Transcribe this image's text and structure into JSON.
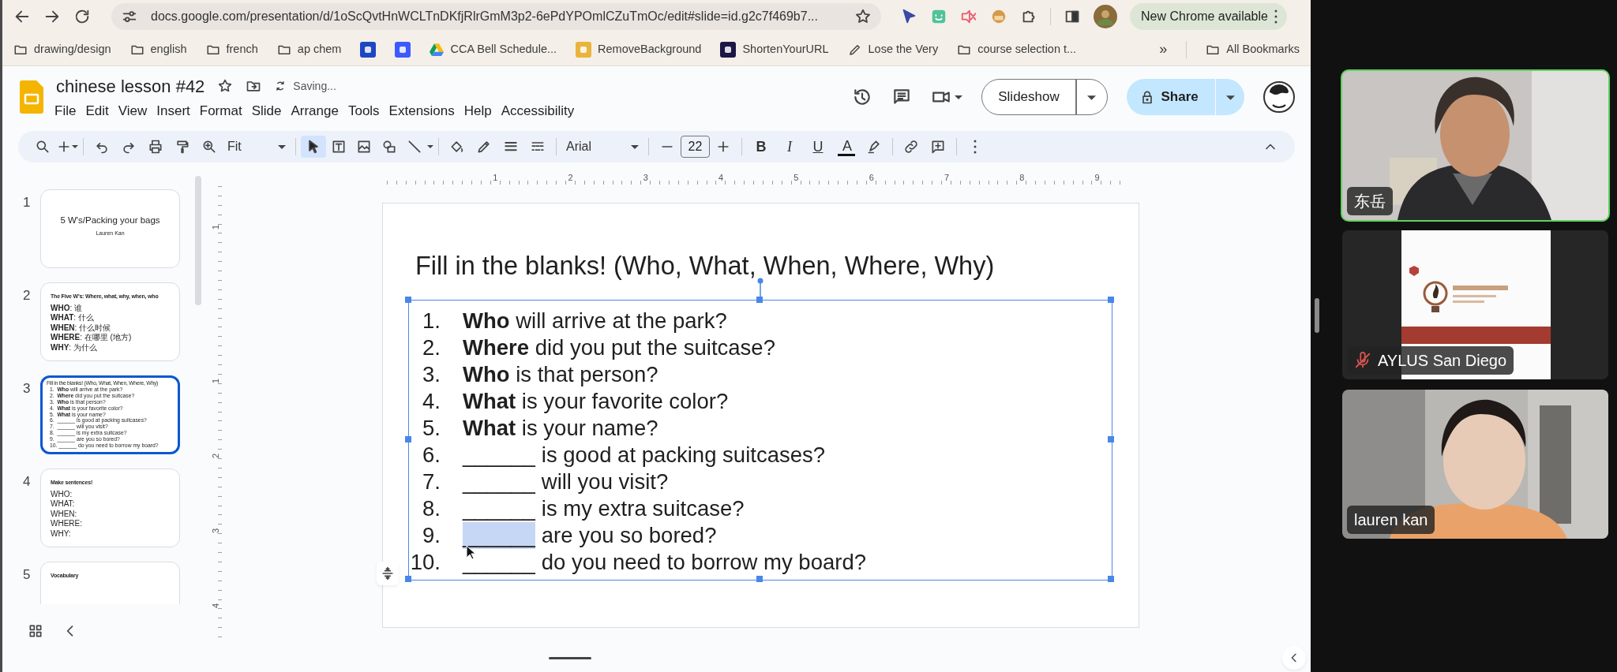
{
  "browser": {
    "url": "docs.google.com/presentation/d/1oScQvtHnWCLTnDKfjRlrGmM3p2-6ePdYPOmlCZuTmOc/edit#slide=id.g2c7f469b7...",
    "update_button": "New Chrome available",
    "bookmarks": [
      {
        "kind": "folder",
        "label": "drawing/design"
      },
      {
        "kind": "folder",
        "label": "english"
      },
      {
        "kind": "folder",
        "label": "french"
      },
      {
        "kind": "folder",
        "label": "ap chem"
      },
      {
        "kind": "favicon",
        "color": "#1e46c4"
      },
      {
        "kind": "favicon",
        "color": "#3d5afe"
      },
      {
        "kind": "drive",
        "label": "CCA Bell Schedule..."
      },
      {
        "kind": "favicon",
        "color": "#e9b43c",
        "label": "RemoveBackground"
      },
      {
        "kind": "favicon",
        "color": "#1c1845",
        "label": "ShortenYourURL"
      },
      {
        "kind": "pencil",
        "label": "Lose the Very"
      },
      {
        "kind": "folder",
        "label": "course selection t..."
      }
    ],
    "overflow": "»",
    "all_bookmarks": "All Bookmarks"
  },
  "app": {
    "title": "chinese lesson #42",
    "save_status": "Saving...",
    "menu": [
      "File",
      "Edit",
      "View",
      "Insert",
      "Format",
      "Slide",
      "Arrange",
      "Tools",
      "Extensions",
      "Help",
      "Accessibility"
    ],
    "slideshow_button": "Slideshow",
    "share_button": "Share"
  },
  "toolbar": {
    "zoom": "Fit",
    "tools": [
      {
        "selected": true
      },
      {
        "selected": false
      },
      {
        "selected": false
      },
      {
        "selected": false
      },
      {
        "selected": false
      }
    ],
    "font": "Arial",
    "font_size": "22",
    "format_buttons": [
      "B",
      "I",
      "U",
      "A"
    ]
  },
  "rulers": {
    "horizontal": [
      "1",
      "2",
      "3",
      "4",
      "5",
      "6",
      "7",
      "8",
      "9"
    ],
    "vertical": [
      "1",
      "1",
      "2",
      "3",
      "4"
    ]
  },
  "thumbnails": [
    {
      "number": "1",
      "selected": false,
      "kind": "title",
      "title": "5 W's/Packing your bags",
      "subtitle": "Lauren Kan"
    },
    {
      "number": "2",
      "selected": false,
      "kind": "list",
      "heading": "The Five W's: Where, what, why, when, who",
      "lines": [
        "**WHO**: 谁",
        "**WHAT**: 什么",
        "**WHEN**: 什么时候",
        "**WHERE**: 在哪里 (地方)",
        "**WHY**: 为什么"
      ]
    },
    {
      "number": "3",
      "selected": true,
      "kind": "numbered",
      "heading": "Fill in the blanks! (Who, What, When, Where, Why)",
      "lines": [
        "1.  **Who** will arrive at the park?",
        "2.  **Where** did you put the suitcase?",
        "3.  **Who** is that person?",
        "4.  **What** is your favorite color?",
        "5.  **What** is your name?",
        "6.  ______ is good at packing suitcases?",
        "7.  ______ will you visit?",
        "8.  ______ is my extra suitcase?",
        "9.  ______ are you so bored?",
        "10. ______ do you need to borrow my board?"
      ]
    },
    {
      "number": "4",
      "selected": false,
      "kind": "list",
      "heading": "Make sentences!",
      "lines": [
        "WHO:",
        "WHAT:",
        "WHEN:",
        "WHERE:",
        "WHY:"
      ]
    },
    {
      "number": "5",
      "selected": false,
      "kind": "list",
      "heading": "Vocabulary"
    }
  ],
  "slide": {
    "title": "Fill in the blanks! (Who, What, When, Where, Why)",
    "items": [
      {
        "number": "1.",
        "text": "**Who** will arrive at the park?",
        "selected": false
      },
      {
        "number": "2.",
        "text": "**Where** did you put the suitcase?",
        "selected": false
      },
      {
        "number": "3.",
        "text": "**Who** is that person?",
        "selected": false
      },
      {
        "number": "4.",
        "text": "**What** is your favorite color?",
        "selected": false
      },
      {
        "number": "5.",
        "text": "**What** is your name?",
        "selected": false
      },
      {
        "number": "6.",
        "blank": "______",
        "text": "is good at packing suitcases?",
        "selected": false
      },
      {
        "number": "7.",
        "blank": "______",
        "text": "will you visit?",
        "selected": false
      },
      {
        "number": "8.",
        "blank": "______",
        "text": "is my extra suitcase?",
        "selected": false
      },
      {
        "number": "9.",
        "blank": "______",
        "text": "are you so bored?",
        "selected": true
      },
      {
        "number": "10.",
        "blank": "______",
        "text": "do you need to borrow my board?",
        "selected": false
      }
    ]
  },
  "participants": [
    {
      "name": "东岳",
      "speaking": true,
      "muted": false
    },
    {
      "name": "AYLUS San Diego",
      "speaking": false,
      "muted": true
    },
    {
      "name": "lauren kan",
      "speaking": false,
      "muted": false
    }
  ]
}
